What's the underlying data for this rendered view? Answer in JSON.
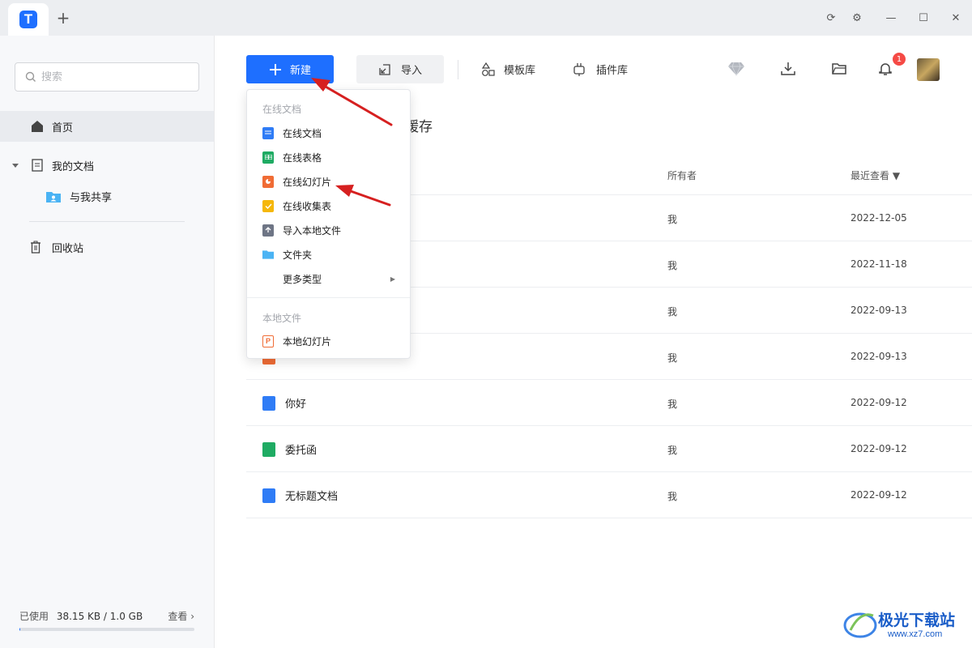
{
  "titlebar": {
    "logo": "T",
    "new_tab": "+",
    "refresh_icon": "⟳",
    "settings_icon": "⚙",
    "minimize": "—",
    "maximize": "☐",
    "close": "✕"
  },
  "sidebar": {
    "search_placeholder": "搜索",
    "items": [
      {
        "label": "首页",
        "icon": "home-icon",
        "active": true
      },
      {
        "label": "我的文档",
        "icon": "document-icon",
        "expanded": true
      },
      {
        "label": "与我共享",
        "icon": "shared-folder-icon"
      },
      {
        "label": "回收站",
        "icon": "trash-icon"
      }
    ],
    "storage": {
      "label": "已使用",
      "value": "38.15 KB / 1.0 GB",
      "view": "查看 ›",
      "fraction": 0.0001
    }
  },
  "toolbar": {
    "new_label": "新建",
    "import_label": "导入",
    "template_label": "模板库",
    "plugin_label": "插件库",
    "notification_count": "1",
    "icons": [
      "diamond-icon",
      "download-icon",
      "folder-icon",
      "bell-icon"
    ]
  },
  "main": {
    "section_title_tail": "缓存",
    "columns": {
      "owner": "所有者",
      "recent": "最近查看 ▼"
    },
    "rows": [
      {
        "name": "",
        "owner": "我",
        "date": "2022-12-05",
        "type": "doc"
      },
      {
        "name": "",
        "owner": "我",
        "date": "2022-11-18",
        "type": "doc"
      },
      {
        "name": "",
        "owner": "我",
        "date": "2022-09-13",
        "type": "doc"
      },
      {
        "name": "",
        "owner": "我",
        "date": "2022-09-13",
        "type": "slide"
      },
      {
        "name": "你好",
        "owner": "我",
        "date": "2022-09-12",
        "type": "doc"
      },
      {
        "name": "委托函",
        "owner": "我",
        "date": "2022-09-12",
        "type": "sheet"
      },
      {
        "name": "无标题文档",
        "owner": "我",
        "date": "2022-09-12",
        "type": "doc"
      }
    ]
  },
  "menu": {
    "online_group": "在线文档",
    "online_items": [
      {
        "label": "在线文档",
        "icon": "doc-icon",
        "color": "#2f7cf6"
      },
      {
        "label": "在线表格",
        "icon": "sheet-icon",
        "color": "#1fab63"
      },
      {
        "label": "在线幻灯片",
        "icon": "slide-icon",
        "color": "#f06c35"
      },
      {
        "label": "在线收集表",
        "icon": "form-icon",
        "color": "#f5b70a"
      },
      {
        "label": "导入本地文件",
        "icon": "upload-icon",
        "color": "#6e7585"
      },
      {
        "label": "文件夹",
        "icon": "folder-icon",
        "color": "#4ab3f4"
      },
      {
        "label": "更多类型",
        "icon": "none",
        "color": ""
      }
    ],
    "local_group": "本地文件",
    "local_items": [
      {
        "label": "本地幻灯片",
        "icon": "ppt-icon",
        "color": "#f06c35"
      }
    ]
  },
  "watermark": {
    "text": "极光下载站",
    "url": "www.xz7.com"
  },
  "colors": {
    "accent": "#1e6fff",
    "annotation": "#d62020"
  }
}
